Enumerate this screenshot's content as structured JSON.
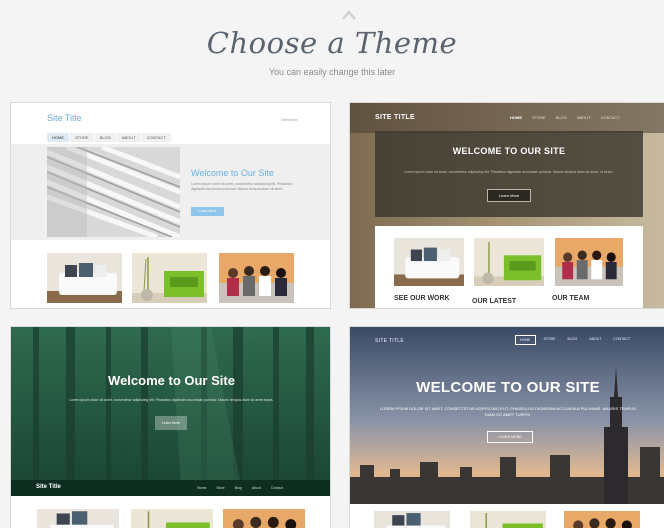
{
  "header": {
    "title": "Choose a Theme",
    "subtitle": "You can easily change this later"
  },
  "themes": [
    {
      "site_title": "Site Title",
      "search_label": "Welcome",
      "nav": [
        "HOME",
        "STORE",
        "BLOG",
        "ABOUT",
        "CONTACT"
      ],
      "hero_title": "Welcome to Our Site",
      "hero_body": "Lorem ipsum dolor sit amet, consectetur adipiscing elit. Phasellus dignissim accumsan pulvinar. Mauris tempus diam sit amet.",
      "hero_button": "Learn More"
    },
    {
      "site_title": "SITE TITLE",
      "nav": [
        "HOME",
        "STORE",
        "BLOG",
        "ABOUT",
        "CONTACT"
      ],
      "hero_title": "WELCOME TO OUR SITE",
      "hero_body": "Lorem ipsum dolor sit amet, consectetur adipiscing elit. Phasellus dignissim accumsan pulvinar. Mauris tempus diam sit amet, ut lorem.",
      "hero_button": "Learn More",
      "columns": [
        "SEE OUR WORK",
        "OUR LATEST",
        "OUR TEAM"
      ]
    },
    {
      "site_title": "Site Title",
      "nav": [
        "Home",
        "Store",
        "Blog",
        "About",
        "Contact"
      ],
      "hero_title": "Welcome to Our Site",
      "hero_body": "Lorem ipsum dolor sit amet, consectetur adipiscing elit. Phasellus dignissim accumsan pulvinar. Mauris tempus diam sit amet turpis.",
      "hero_button": "Learn More"
    },
    {
      "site_title": "SITE TITLE",
      "nav": [
        "HOME",
        "STORE",
        "BLOG",
        "ABOUT",
        "CONTACT"
      ],
      "hero_title": "WELCOME TO OUR SITE",
      "hero_body": "LOREM IPSUM DOLOR SIT AMET, CONSECTETUR ADIPISCING ELIT. PHASELLUS DIGNISSIM ACCUMSAN PULVINAR. MAURIS TEMPUS DIAM SIT AMET TURPIS.",
      "hero_button": "LEARN MORE"
    }
  ],
  "colors": {
    "accent_blue": "#6bb1e0",
    "heading": "#5a6470",
    "forest": "#1d4a38"
  }
}
